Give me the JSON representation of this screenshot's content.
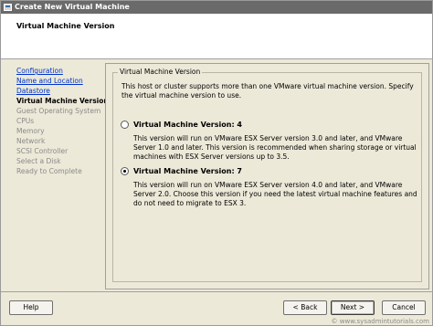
{
  "window": {
    "title": "Create New Virtual Machine"
  },
  "header": {
    "title": "Virtual Machine Version"
  },
  "steps": [
    {
      "label": "Configuration",
      "state": "done"
    },
    {
      "label": "Name and Location",
      "state": "done"
    },
    {
      "label": "Datastore",
      "state": "done"
    },
    {
      "label": "Virtual Machine Version",
      "state": "current"
    },
    {
      "label": "Guest Operating System",
      "state": "pending"
    },
    {
      "label": "CPUs",
      "state": "pending"
    },
    {
      "label": "Memory",
      "state": "pending"
    },
    {
      "label": "Network",
      "state": "pending"
    },
    {
      "label": "SCSI Controller",
      "state": "pending"
    },
    {
      "label": "Select a Disk",
      "state": "pending"
    },
    {
      "label": "Ready to Complete",
      "state": "pending"
    }
  ],
  "group": {
    "legend": "Virtual Machine Version",
    "intro": "This host or cluster supports more than one VMware virtual machine version. Specify the virtual machine version to use."
  },
  "options": [
    {
      "label": "Virtual Machine Version: 4",
      "checked": false,
      "description": "This version will run on VMware ESX Server version 3.0 and later, and VMware Server 1.0 and later. This version is recommended when sharing storage or virtual machines with ESX Server versions up to 3.5."
    },
    {
      "label": "Virtual Machine Version: 7",
      "checked": true,
      "description": "This version will run on VMware ESX Server version 4.0 and later, and VMware Server 2.0. Choose this version if you need the latest virtual machine features and do not need to migrate to ESX 3."
    }
  ],
  "footer": {
    "help_label": "Help",
    "back_label": "< Back",
    "next_label": "Next >",
    "cancel_label": "Cancel"
  },
  "watermark": "© www.sysadmintutorials.com"
}
